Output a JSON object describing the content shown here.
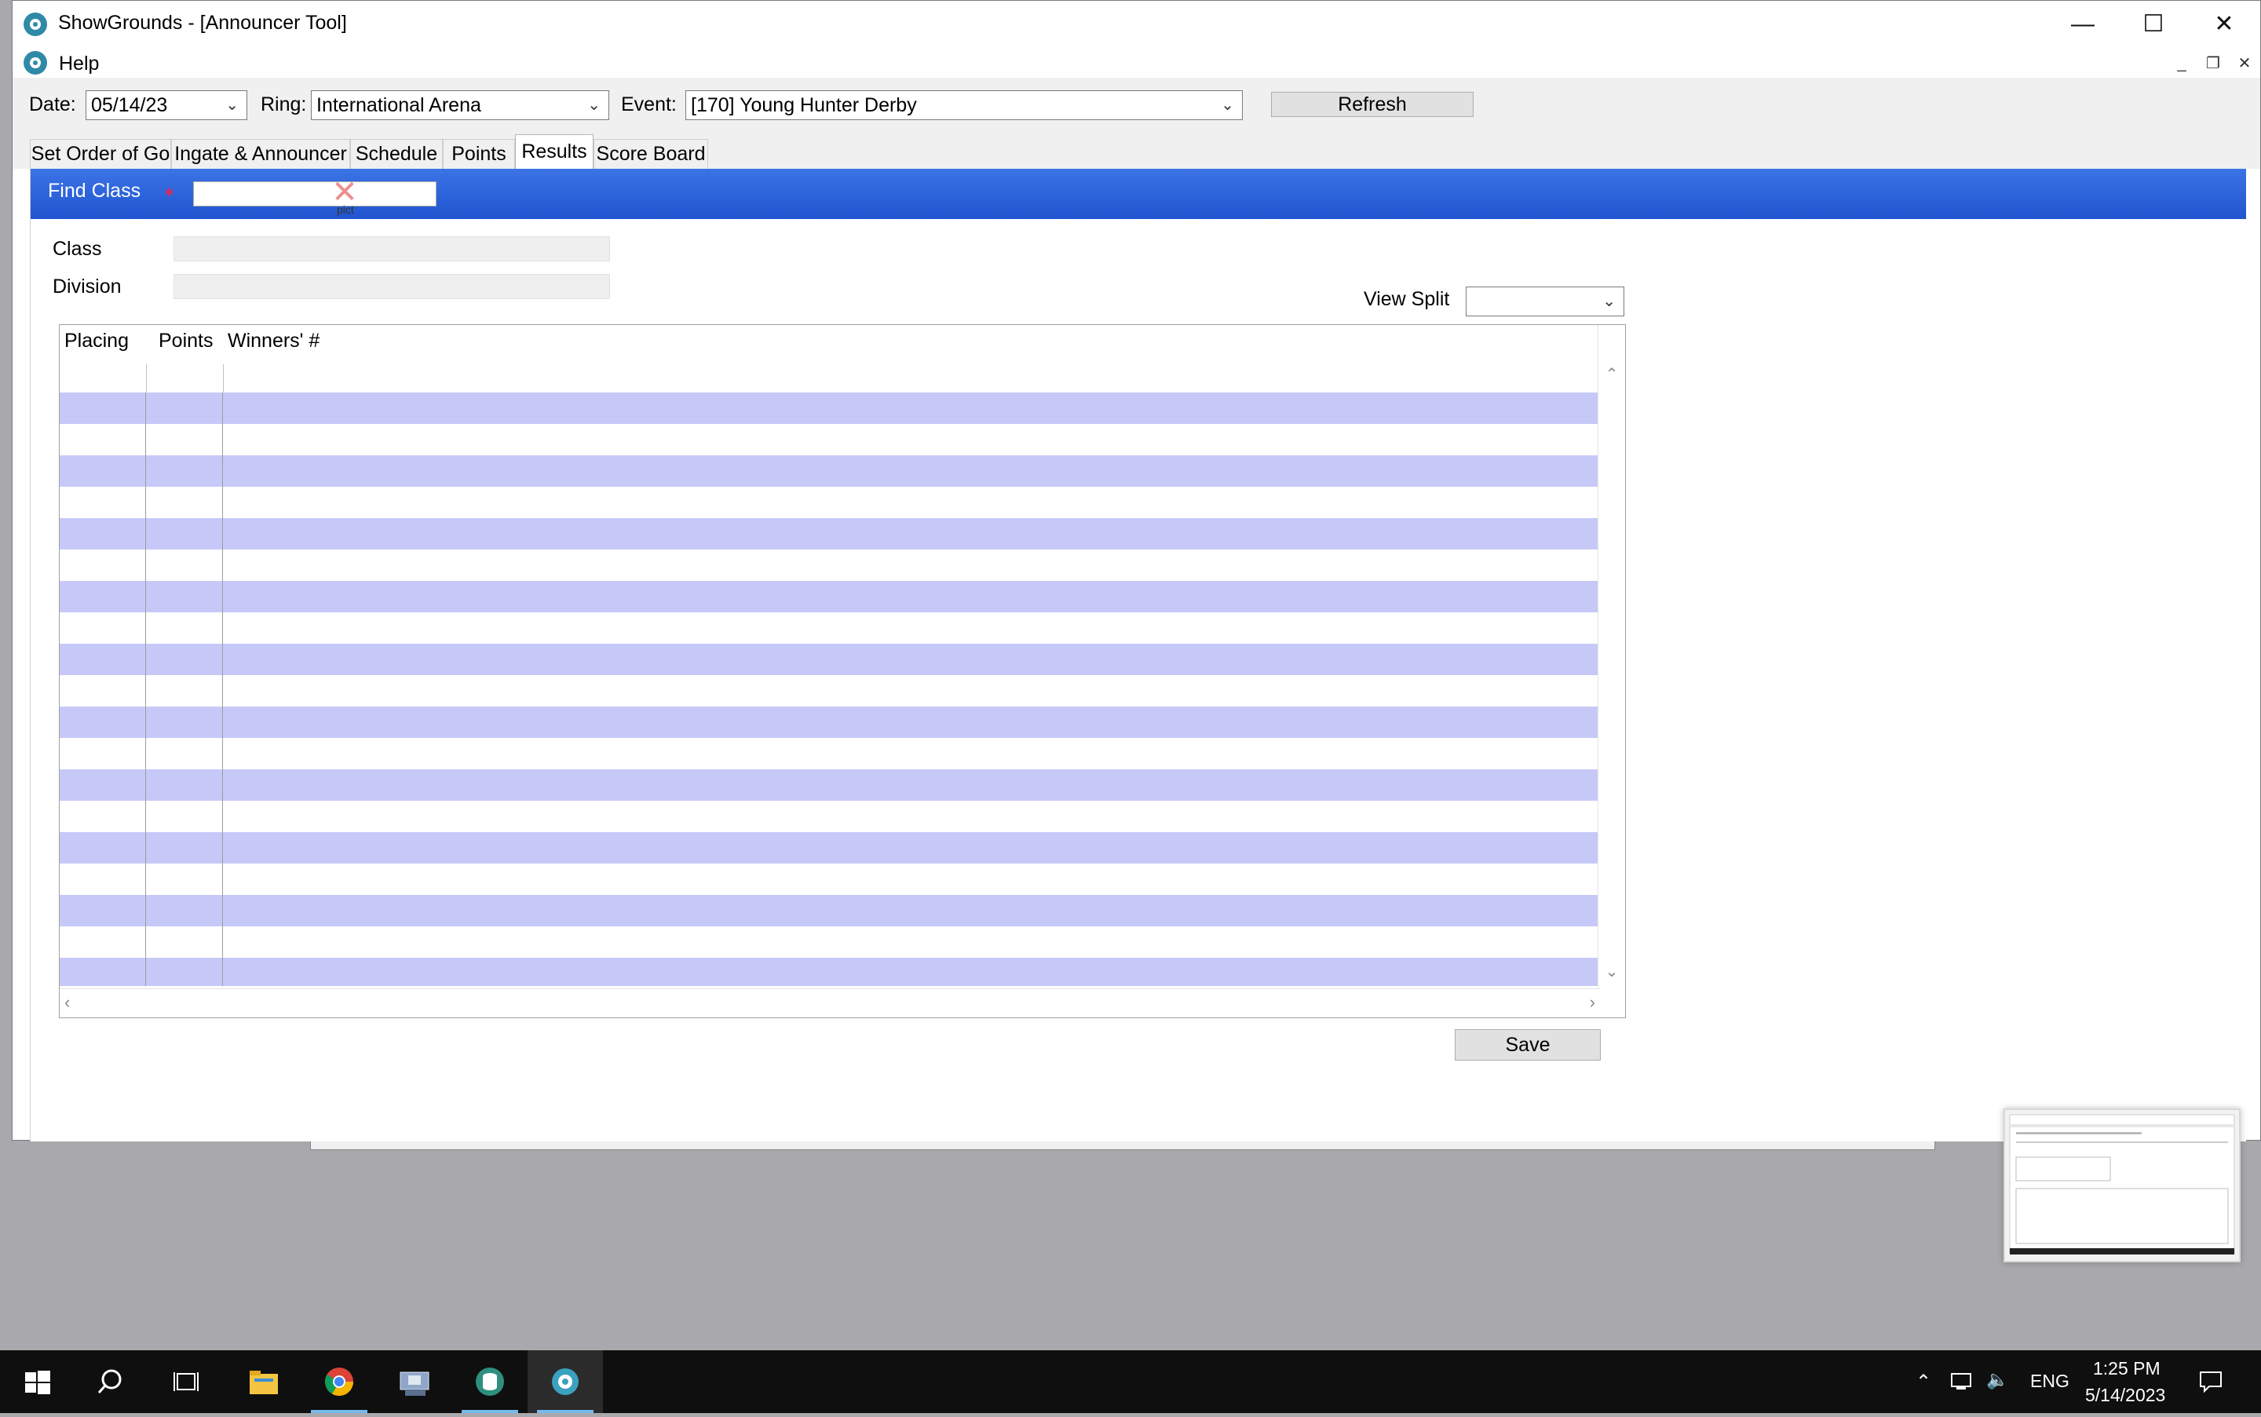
{
  "window": {
    "title": "ShowGrounds - [Announcer Tool]",
    "controls": {
      "minimize": "—",
      "maximize": "☐",
      "close": "✕"
    }
  },
  "menu": {
    "help": "Help",
    "mdi_controls": {
      "minimize": "_",
      "restore": "❐",
      "close": "✕"
    }
  },
  "toolbar": {
    "date_label": "Date:",
    "date_value": "05/14/23",
    "ring_label": "Ring:",
    "ring_value": "International Arena",
    "event_label": "Event:",
    "event_value": "[170] Young Hunter Derby",
    "refresh_label": "Refresh"
  },
  "tabs": [
    {
      "label": "Set Order of Go",
      "active": false
    },
    {
      "label": "Ingate & Announcer",
      "active": false
    },
    {
      "label": "Schedule",
      "active": false
    },
    {
      "label": "Points",
      "active": false
    },
    {
      "label": "Results",
      "active": true
    },
    {
      "label": "Score Board",
      "active": false
    }
  ],
  "find": {
    "label": "Find Class",
    "value": "",
    "image_placeholder_text": "pict"
  },
  "form": {
    "class_label": "Class",
    "class_value": "",
    "division_label": "Division",
    "division_value": "",
    "view_split_label": "View Split",
    "view_split_value": ""
  },
  "grid": {
    "columns": [
      "Placing",
      "Points",
      "Winners' #"
    ],
    "row_count": 19,
    "rows_filled": 0,
    "alt_row_color": "#c6c9f7"
  },
  "save_label": "Save",
  "taskbar": {
    "apps": [
      "start-icon",
      "search-icon",
      "task-view-icon",
      "file-explorer-icon",
      "chrome-icon",
      "network-app-icon",
      "database-app-icon",
      "showgrounds-icon"
    ],
    "language": "ENG",
    "time": "1:25 PM",
    "date": "5/14/2023"
  },
  "colors": {
    "find_bar": "#2a5fd8",
    "desktop": "#a9a8ac",
    "taskbar": "#0f0f0f"
  }
}
